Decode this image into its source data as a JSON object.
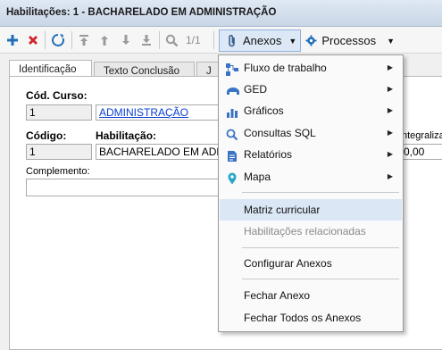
{
  "window": {
    "title": "Habilitações: 1 - BACHARELADO EM ADMINISTRAÇÃO"
  },
  "toolbar": {
    "counter": "1/1",
    "anexos_label": "Anexos",
    "processos_label": "Processos",
    "icons": [
      "add-icon",
      "delete-icon",
      "refresh-icon",
      "first-icon",
      "previous-icon",
      "next-icon",
      "last-icon",
      "search-icon",
      "clip-icon",
      "gear-icon"
    ]
  },
  "tabs": [
    {
      "label": "Identificação"
    },
    {
      "label": "Texto Conclusão"
    },
    {
      "label": "J"
    }
  ],
  "form": {
    "cod_curso_label": "Cód. Curso:",
    "cod_curso_value": "1",
    "curso_nome": "ADMINISTRAÇÃO",
    "codigo_label": "Código:",
    "codigo_value": "1",
    "habilitacao_label": "Habilitação:",
    "habilitacao_value": "BACHARELADO EM ADMINISTRAÇÃO",
    "integraliz_label": "ntegraliza",
    "integraliz_value": "0,00",
    "complemento_label": "Complemento:",
    "complemento_value": ""
  },
  "menu": {
    "items": [
      {
        "label": "Fluxo de trabalho",
        "icon": "workflow-icon",
        "submenu": true
      },
      {
        "label": "GED",
        "icon": "ged-icon",
        "submenu": true
      },
      {
        "label": "Gráficos",
        "icon": "chart-icon",
        "submenu": true
      },
      {
        "label": "Consultas SQL",
        "icon": "search-icon",
        "submenu": true
      },
      {
        "label": "Relatórios",
        "icon": "report-icon",
        "submenu": true
      },
      {
        "label": "Mapa",
        "icon": "map-pin-icon",
        "submenu": true
      },
      {
        "label": "Matriz curricular",
        "highlighted": true
      },
      {
        "label": "Habilitações relacionadas",
        "disabled": true
      },
      {
        "label": "Configurar Anexos"
      },
      {
        "label": "Fechar Anexo"
      },
      {
        "label": "Fechar Todos os Anexos"
      }
    ],
    "colors": {
      "highlight": "#dce7f5",
      "icon_blue": "#3a73c4"
    }
  }
}
